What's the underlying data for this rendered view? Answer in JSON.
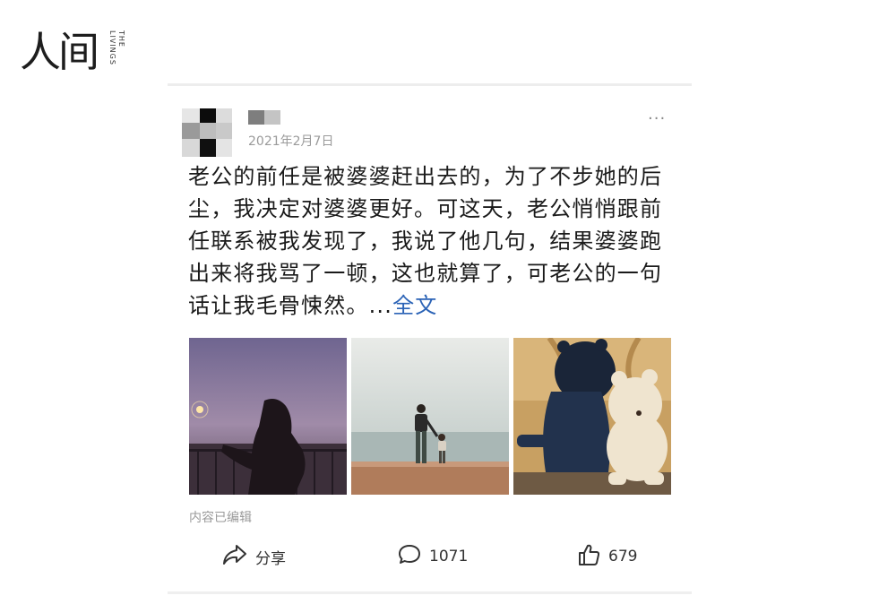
{
  "logo": {
    "main": "人间",
    "sub": "THE LIVINGS"
  },
  "post": {
    "date": "2021年2月7日",
    "more_label": "···",
    "text": "老公的前任是被婆婆赶出去的，为了不步她的后尘，我决定对婆婆更好。可这天，老公悄悄跟前任联系被我发现了，我说了他几句，结果婆婆跑出来将我骂了一顿，这也就算了，可老公的一句话让我毛骨悚然。...",
    "full_link": "全文",
    "edited_label": "内容已编辑",
    "photos": [
      {
        "icon": "photo-girl-sparkler"
      },
      {
        "icon": "photo-parent-child-beach"
      },
      {
        "icon": "photo-child-teddy-bear"
      }
    ]
  },
  "actions": {
    "share": {
      "icon": "share-icon",
      "label": "分享"
    },
    "comment": {
      "icon": "comment-icon",
      "count": "1071"
    },
    "like": {
      "icon": "thumbs-up-icon",
      "count": "679"
    }
  },
  "colors": {
    "link": "#2b63b6",
    "meta": "#9a9a9a",
    "text": "#1a1a1a"
  }
}
